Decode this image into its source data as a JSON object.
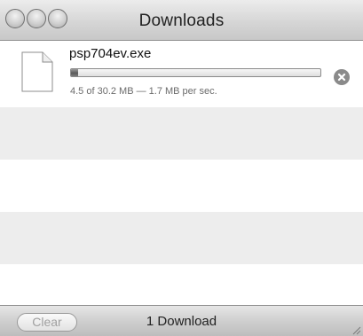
{
  "window": {
    "title": "Downloads"
  },
  "downloads": [
    {
      "file_name": "psp704ev.exe",
      "status": "4.5 of 30.2 MB — 1.7 MB per sec.",
      "progress": 0.03,
      "icon": "document-icon"
    }
  ],
  "footer": {
    "clear_label": "Clear",
    "count_text": "1 Download"
  },
  "colors": {
    "stripe": "#ededed",
    "chrome": "#d0d0d0"
  }
}
